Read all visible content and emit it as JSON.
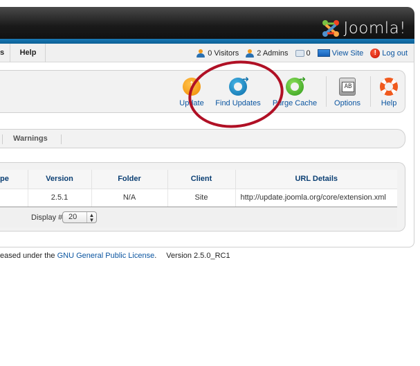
{
  "header": {
    "logo_text": "Joomla!",
    "logo_mark": "®"
  },
  "menubar": {
    "partial_item": "s",
    "help_label": "Help",
    "status": {
      "visitors": "0 Visitors",
      "admins": "2 Admins",
      "messages": "0",
      "view_site": "View Site",
      "logout": "Log out"
    }
  },
  "toolbar": {
    "buttons": [
      {
        "label": "Update",
        "icon": "update-icon"
      },
      {
        "label": "Find Updates",
        "icon": "find-updates-icon"
      },
      {
        "label": "Purge Cache",
        "icon": "purge-cache-icon"
      },
      {
        "label": "Options",
        "icon": "options-icon"
      },
      {
        "label": "Help",
        "icon": "help-icon"
      }
    ]
  },
  "submenu": {
    "warnings_label": "Warnings"
  },
  "table": {
    "headers": [
      "pe",
      "Version",
      "Folder",
      "Client",
      "URL Details"
    ],
    "rows": [
      {
        "type": "",
        "version": "2.5.1",
        "folder": "N/A",
        "client": "Site",
        "url": "http://update.joomla.org/core/extension.xml"
      }
    ],
    "display_label": "Display #",
    "display_value": "20",
    "display_arrows": "▲▼"
  },
  "footer": {
    "prefix": "eased under the ",
    "license_link": "GNU General Public License",
    "suffix": ".",
    "version": "Version 2.5.0_RC1"
  },
  "colors": {
    "accent_blue": "#0b55a0",
    "highlight_red": "#b01025"
  }
}
